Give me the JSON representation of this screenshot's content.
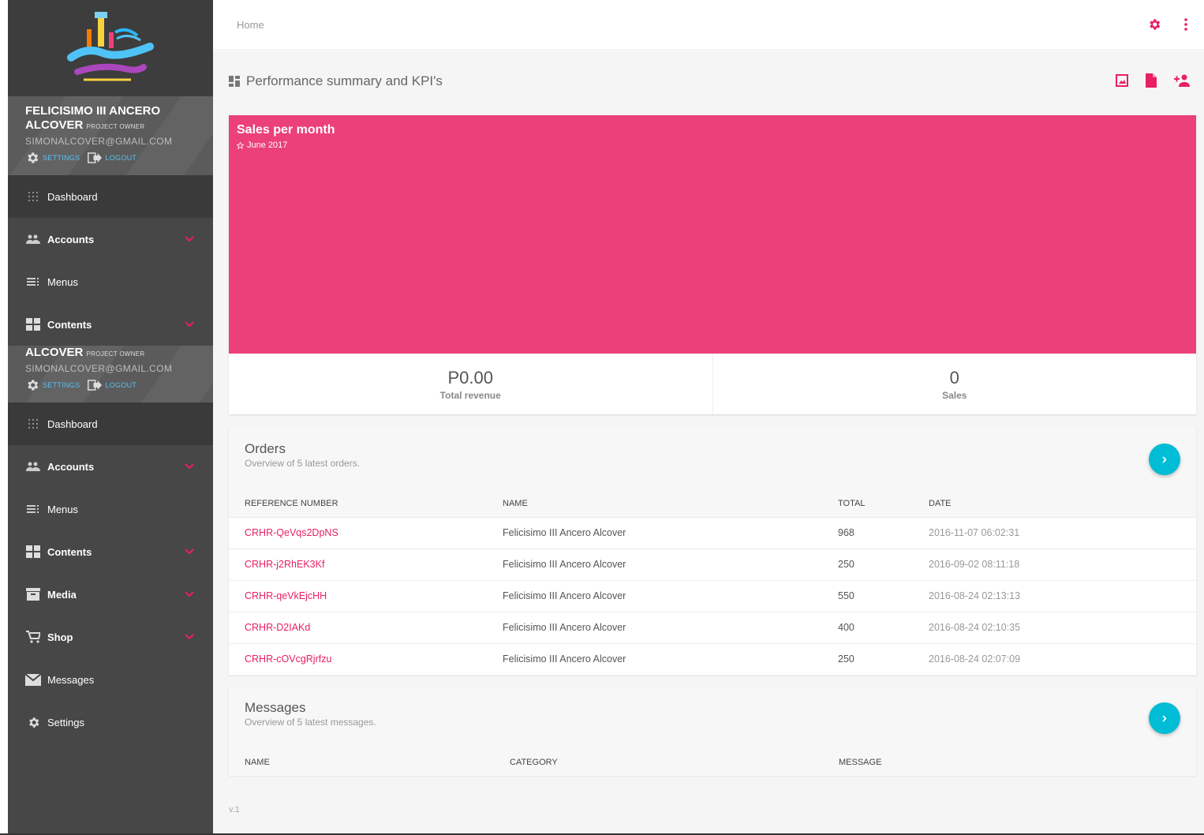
{
  "colors": {
    "accent": "#e91e63",
    "chart_bg": "#ec407a",
    "button": "#00bcd4",
    "sidebar": "#474747"
  },
  "sidebar": {
    "logo_alt": "Sky Experience Adventure",
    "profile": {
      "name_line1": "FELICISIMO III ANCERO",
      "name_line2": "ALCOVER",
      "role": "PROJECT OWNER",
      "email": "SIMONALCOVER@GMAIL.COM",
      "settings_label": "SETTINGS",
      "logout_label": "LOGOUT"
    },
    "profile_repeat": {
      "name_line2": "ALCOVER",
      "role": "PROJECT OWNER",
      "email": "SIMONALCOVER@GMAIL.COM",
      "settings_label": "SETTINGS",
      "logout_label": "LOGOUT"
    },
    "nav_first": [
      {
        "label": "Dashboard",
        "icon": "grid-dots-icon",
        "active": true
      },
      {
        "label": "Accounts",
        "icon": "people-icon",
        "expandable": true
      },
      {
        "label": "Menus",
        "icon": "menu-lines-icon"
      },
      {
        "label": "Contents",
        "icon": "tiles-icon",
        "expandable": true
      }
    ],
    "nav_second": [
      {
        "label": "Dashboard",
        "icon": "grid-dots-icon",
        "active": true
      },
      {
        "label": "Accounts",
        "icon": "people-icon",
        "expandable": true
      },
      {
        "label": "Menus",
        "icon": "menu-lines-icon"
      },
      {
        "label": "Contents",
        "icon": "tiles-icon",
        "expandable": true
      },
      {
        "label": "Media",
        "icon": "archive-icon",
        "expandable": true
      },
      {
        "label": "Shop",
        "icon": "cart-icon",
        "expandable": true
      },
      {
        "label": "Messages",
        "icon": "envelope-icon"
      },
      {
        "label": "Settings",
        "icon": "gear-icon"
      }
    ]
  },
  "topbar": {
    "breadcrumb": "Home"
  },
  "main": {
    "page_title": "Performance summary and KPI's",
    "sales": {
      "title": "Sales per month",
      "subtitle": "June 2017",
      "kpis": [
        {
          "value": "P0.00",
          "label": "Total revenue"
        },
        {
          "value": "0",
          "label": "Sales"
        }
      ]
    },
    "orders": {
      "title": "Orders",
      "subtitle": "Overview of 5 latest orders.",
      "columns": [
        "REFERENCE NUMBER",
        "NAME",
        "TOTAL",
        "DATE"
      ],
      "rows": [
        {
          "ref": "CRHR-QeVqs2DpNS",
          "name": "Felicisimo III Ancero Alcover",
          "total": "968",
          "date": "2016-11-07 06:02:31"
        },
        {
          "ref": "CRHR-j2RhEK3Kf",
          "name": "Felicisimo III Ancero Alcover",
          "total": "250",
          "date": "2016-09-02 08:11:18"
        },
        {
          "ref": "CRHR-qeVkEjcHH",
          "name": "Felicisimo III Ancero Alcover",
          "total": "550",
          "date": "2016-08-24 02:13:13"
        },
        {
          "ref": "CRHR-D2IAKd",
          "name": "Felicisimo III Ancero Alcover",
          "total": "400",
          "date": "2016-08-24 02:10:35"
        },
        {
          "ref": "CRHR-cOVcgRjrfzu",
          "name": "Felicisimo III Ancero Alcover",
          "total": "250",
          "date": "2016-08-24 02:07:09"
        }
      ]
    },
    "messages": {
      "title": "Messages",
      "subtitle": "Overview of 5 latest messages.",
      "columns": [
        "NAME",
        "CATEGORY",
        "MESSAGE"
      ]
    },
    "version": "v.1"
  }
}
